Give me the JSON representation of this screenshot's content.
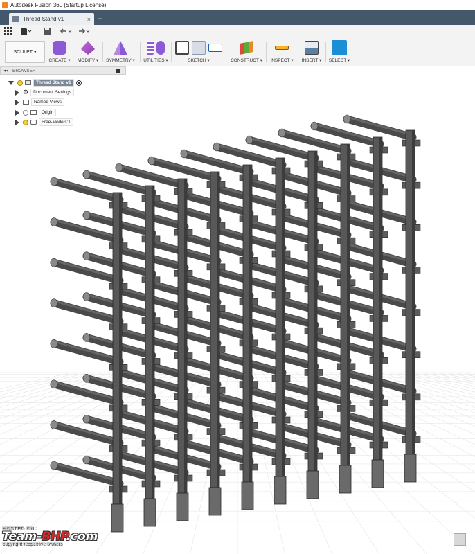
{
  "window": {
    "title": "Autodesk Fusion 360 (Startup License)"
  },
  "tabs": [
    {
      "label": "Thread Stand v1",
      "close": "×"
    }
  ],
  "new_tab": "+",
  "workspace": {
    "label": "SCULPT"
  },
  "toolbar_groups": [
    {
      "label": "CREATE",
      "icons": [
        "create-box-icon"
      ]
    },
    {
      "label": "MODIFY",
      "icons": [
        "modify-icon"
      ]
    },
    {
      "label": "SYMMETRY",
      "icons": [
        "symmetry-icon"
      ]
    },
    {
      "label": "UTILITIES",
      "icons": [
        "utilities-icon",
        "display-icon"
      ]
    },
    {
      "label": "SKETCH",
      "icons": [
        "sketch-icon",
        "arc-icon",
        "rectangle-icon"
      ]
    },
    {
      "label": "CONSTRUCT",
      "icons": [
        "plane-icon"
      ]
    },
    {
      "label": "INSPECT",
      "icons": [
        "measure-icon"
      ]
    },
    {
      "label": "INSERT",
      "icons": [
        "image-icon"
      ]
    },
    {
      "label": "SELECT",
      "icons": [
        "select-icon"
      ]
    }
  ],
  "browser": {
    "header": "BROWSER",
    "root": "Thread Stand v1",
    "items": [
      {
        "label": "Document Settings",
        "icon": "gear-icon"
      },
      {
        "label": "Named Views",
        "icon": "folder-icon"
      },
      {
        "label": "Origin",
        "icon": "folder-icon"
      },
      {
        "label": "Free-Models:1",
        "icon": "component-icon"
      }
    ]
  },
  "watermark": {
    "hosted": "HOSTED ON :",
    "brand_a": "Team-",
    "brand_b": "BHP",
    "brand_c": ".com",
    "copyright": "copyright respective owners"
  },
  "colors": {
    "tabbar": "#44576b",
    "model_dark": "#4a4a4a",
    "model_light": "#7a7a7a",
    "select_blue": "#1a8fd6"
  }
}
